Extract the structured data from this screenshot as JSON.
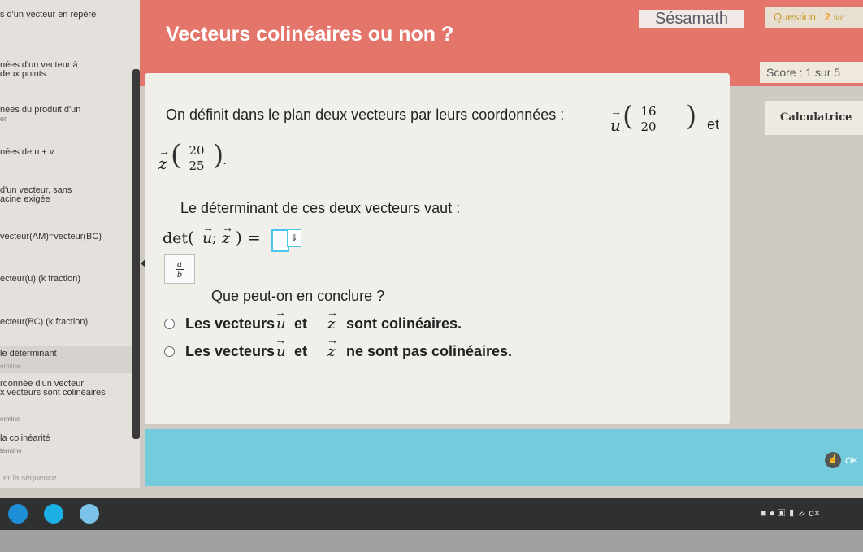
{
  "sidebar": {
    "items": [
      {
        "line1": "s d'un vecteur en repère",
        "line2": ""
      },
      {
        "line1": "nées d'un vecteur à",
        "line2": "deux points."
      },
      {
        "line1": "nées du produit d'un",
        "line2": "er"
      },
      {
        "line1": "nées de u + v",
        "line2": ""
      },
      {
        "line1": "d'un vecteur, sans",
        "line2": "acine exigée"
      },
      {
        "line1": "vecteur(AM)=vecteur(BC)",
        "line2": ""
      },
      {
        "line1": "ecteur(u) (k fraction)",
        "line2": ""
      },
      {
        "line1": "ecteur(BC) (k fraction)",
        "line2": ""
      },
      {
        "line1": "le déterminant",
        "line2": "ermine"
      },
      {
        "line1": "rdonnée d'un vecteur",
        "line2": "x vecteurs sont colinéaires"
      },
      {
        "line1": "ermine",
        "line2": ""
      },
      {
        "line1": "la colinéarité",
        "line2": "termine"
      }
    ],
    "sequence_button": "er la séquence"
  },
  "header": {
    "title": "Vecteurs colinéaires ou non ?",
    "brand": "Sésamath",
    "question_label": "Question :",
    "question_number": "2",
    "question_suffix": "sur",
    "score": "Score : 1 sur 5"
  },
  "calculator_label": "Calculatrice",
  "exercise": {
    "intro": "On définit dans le plan deux vecteurs par leurs coordonnées :",
    "vector_u": {
      "name": "u",
      "x": "16",
      "y": "20"
    },
    "connector": "et",
    "vector_z": {
      "name": "z",
      "x": "20",
      "y": "25"
    },
    "period": ".",
    "determinant_prompt": "Le déterminant de ces deux vecteurs vaut :",
    "det_label": "det",
    "det_open": "(",
    "det_sep": ";",
    "det_close": ") =",
    "det_value": "",
    "dropdown_symbol": "⇓",
    "fraction_button": {
      "num": "a",
      "den": "b"
    },
    "conclusion_prompt": "Que peut-on en conclure ?",
    "options": [
      {
        "prefix": "Les vecteurs",
        "mid": "et",
        "suffix": "sont colinéaires."
      },
      {
        "prefix": "Les vecteurs",
        "mid": "et",
        "suffix": "ne sont pas colinéaires."
      }
    ]
  },
  "footer": {
    "ok_label": "OK"
  },
  "taskbar": {
    "tray_text": "ᨀ d×"
  },
  "colors": {
    "header": "#e4756a",
    "footer": "#72ccdc",
    "accent_input": "#4bc6ea"
  }
}
